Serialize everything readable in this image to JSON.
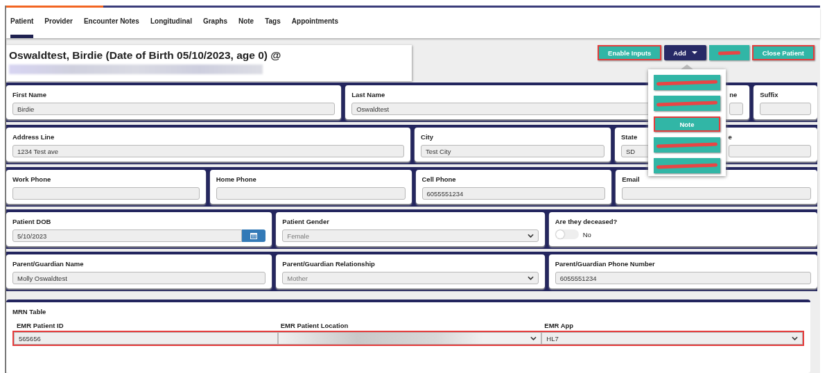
{
  "tabs": [
    {
      "label": "Patient",
      "selected": true
    },
    {
      "label": "Provider",
      "selected": false
    },
    {
      "label": "Encounter Notes",
      "selected": false
    },
    {
      "label": "Longitudinal",
      "selected": false
    },
    {
      "label": "Graphs",
      "selected": false
    },
    {
      "label": "Note",
      "selected": false
    },
    {
      "label": "Tags",
      "selected": false
    },
    {
      "label": "Appointments",
      "selected": false
    }
  ],
  "header": {
    "title": "Oswaldtest, Birdie (Date of Birth 05/10/2023, age 0) @"
  },
  "actions": [
    {
      "kind": "button",
      "label": "Enable Inputs",
      "highlighted": true
    },
    {
      "kind": "dropdown",
      "label": "Add",
      "highlighted": false
    },
    {
      "kind": "redacted",
      "highlighted": false
    },
    {
      "kind": "button",
      "label": "Close Patient",
      "highlighted": true
    }
  ],
  "add_menu": {
    "items": [
      {
        "kind": "redacted",
        "highlighted": false
      },
      {
        "kind": "redacted",
        "highlighted": false
      },
      {
        "kind": "item",
        "label": "Note",
        "highlighted": true
      },
      {
        "kind": "redacted",
        "highlighted": false
      },
      {
        "kind": "redacted",
        "highlighted": false
      }
    ]
  },
  "rows": [
    [
      {
        "kind": "text",
        "label": "First Name",
        "value": "Birdie"
      },
      {
        "kind": "text",
        "label": "Last Name",
        "value": "Oswaldtest"
      },
      {
        "kind": "text",
        "label": "ne"
      },
      {
        "kind": "text",
        "label": "Suffix"
      }
    ],
    [
      {
        "kind": "text",
        "label": "Address Line",
        "value": "1234 Test ave"
      },
      {
        "kind": "text",
        "label": "City",
        "value": "Test City"
      },
      {
        "kind": "text",
        "label": "State",
        "value": "SD"
      },
      {
        "kind": "text",
        "label": "e"
      }
    ],
    [
      {
        "kind": "text",
        "label": "Work Phone"
      },
      {
        "kind": "text",
        "label": "Home Phone"
      },
      {
        "kind": "text",
        "label": "Cell Phone",
        "value": "6055551234"
      },
      {
        "kind": "text",
        "label": "Email"
      }
    ],
    [
      {
        "kind": "date",
        "label": "Patient DOB",
        "value": "5/10/2023"
      },
      {
        "kind": "select",
        "label": "Patient Gender",
        "value": "Female",
        "disabled": true
      },
      {
        "kind": "toggle",
        "label": "Are they deceased?",
        "on": false,
        "value": "No"
      }
    ],
    [
      {
        "kind": "text",
        "label": "Parent/Guardian Name",
        "value": "Molly Oswaldtest"
      },
      {
        "kind": "select",
        "label": "Parent/Guardian Relationship",
        "value": "Mother",
        "disabled": true
      },
      {
        "kind": "text",
        "label": "Parent/Guardian Phone Number",
        "value": "6055551234"
      }
    ]
  ],
  "mrn_table": {
    "title": "MRN Table",
    "columns": [
      "EMR Patient ID",
      "EMR Patient Location",
      "EMR App"
    ],
    "rows": [
      {
        "highlighted": true,
        "cells": [
          {
            "kind": "text",
            "value": "565656"
          },
          {
            "kind": "redacted-select"
          },
          {
            "kind": "select",
            "value": "HL7",
            "disabled": false
          }
        ]
      }
    ]
  }
}
